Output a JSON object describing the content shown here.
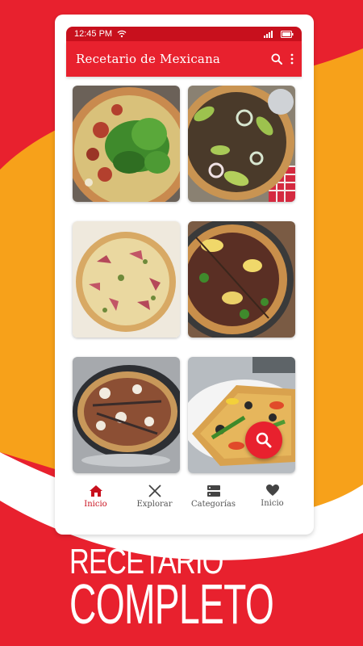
{
  "status_bar": {
    "time": "12:45 PM"
  },
  "app_bar": {
    "title": "Recetario de Mexicana",
    "search_icon": "search-icon",
    "menu_icon": "more-vert-icon"
  },
  "recipes": [
    {
      "image": "pizza-arugula"
    },
    {
      "image": "pizza-avocado-beef"
    },
    {
      "image": "pizza-prosciutto"
    },
    {
      "image": "pizza-bbq"
    },
    {
      "image": "pizza-anchovy"
    },
    {
      "image": "pizza-vegetable"
    }
  ],
  "fab": {
    "icon": "search-icon"
  },
  "bottom_nav": [
    {
      "label": "Inicio",
      "icon": "home-icon",
      "active": true
    },
    {
      "label": "Explorar",
      "icon": "utensils-icon",
      "active": false
    },
    {
      "label": "Categorías",
      "icon": "categories-icon",
      "active": false
    },
    {
      "label": "Inicio",
      "icon": "heart-icon",
      "active": false
    }
  ],
  "promo": {
    "line1": "RECETARIO",
    "line2": "COMPLETO"
  },
  "colors": {
    "primary": "#e8212e",
    "primary_dark": "#c8101d",
    "accent": "#f7a11a",
    "background": "#ffffff"
  }
}
